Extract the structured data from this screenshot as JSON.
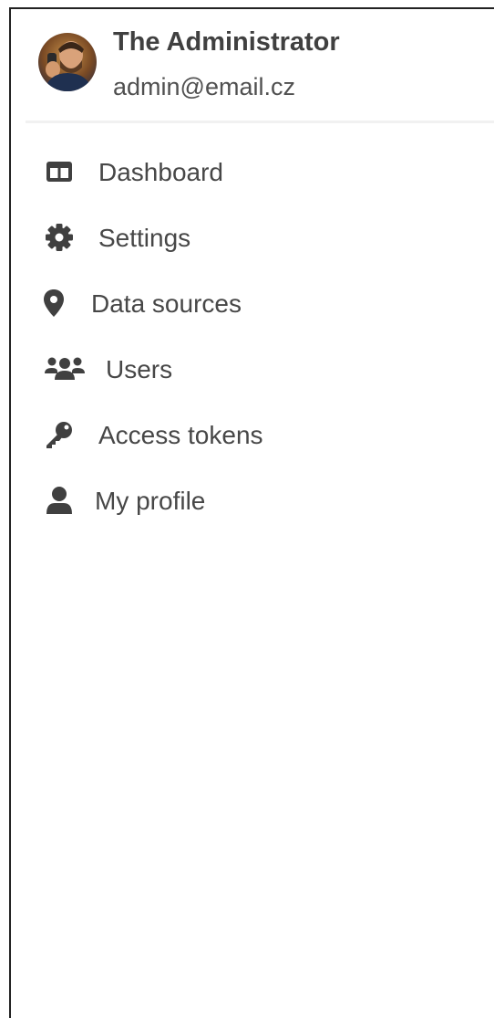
{
  "profile": {
    "name": "The Administrator",
    "email": "admin@email.cz"
  },
  "nav": {
    "items": [
      {
        "label": "Dashboard",
        "icon": "dashboard-columns-icon"
      },
      {
        "label": "Settings",
        "icon": "gear-icon"
      },
      {
        "label": "Data sources",
        "icon": "map-marker-icon"
      },
      {
        "label": "Users",
        "icon": "users-group-icon"
      },
      {
        "label": "Access tokens",
        "icon": "key-icon"
      },
      {
        "label": "My profile",
        "icon": "user-icon"
      }
    ]
  },
  "colors": {
    "text": "#474747",
    "icon": "#404040",
    "divider": "#f1f1f1",
    "border": "#222222"
  }
}
